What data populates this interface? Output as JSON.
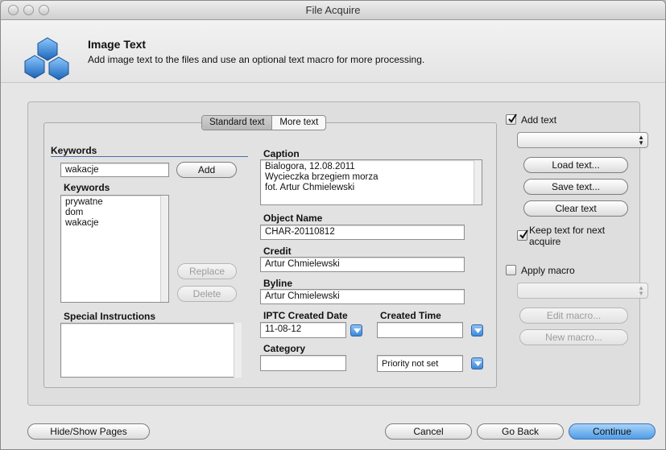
{
  "window": {
    "title": "File Acquire"
  },
  "header": {
    "title": "Image Text",
    "subtitle": "Add image text to the files and use an optional text macro for more processing."
  },
  "tabs": [
    {
      "label": "Standard text",
      "active": true
    },
    {
      "label": "More text",
      "active": false
    }
  ],
  "keywords": {
    "section_label": "Keywords",
    "input_value": "wakacje",
    "add_label": "Add",
    "list_label": "Keywords",
    "items": [
      "prywatne",
      "dom",
      "wakacje"
    ],
    "replace_label": "Replace",
    "delete_label": "Delete"
  },
  "special_instructions": {
    "label": "Special Instructions",
    "value": ""
  },
  "caption": {
    "label": "Caption",
    "lines": [
      "Bialogora, 12.08.2011",
      "Wycieczka brzegiem morza",
      "fot. Artur Chmielewski"
    ]
  },
  "object_name": {
    "label": "Object Name",
    "value": "CHAR-20110812"
  },
  "credit": {
    "label": "Credit",
    "value": "Artur Chmielewski"
  },
  "byline": {
    "label": "Byline",
    "value": "Artur Chmielewski"
  },
  "iptc_created_date": {
    "label": "IPTC Created Date",
    "value": "11-08-12"
  },
  "created_time": {
    "label": "Created Time",
    "value": ""
  },
  "category": {
    "label": "Category",
    "value": ""
  },
  "priority": {
    "value": "Priority not set"
  },
  "sidebar": {
    "add_text_label": "Add text",
    "add_text_checked": true,
    "text_select_value": "",
    "load_text_label": "Load text...",
    "save_text_label": "Save text...",
    "clear_text_label": "Clear text",
    "keep_text_label_1": "Keep text for next",
    "keep_text_label_2": "acquire",
    "keep_text_checked": true,
    "apply_macro_label": "Apply macro",
    "apply_macro_checked": false,
    "macro_select_value": "",
    "edit_macro_label": "Edit macro...",
    "new_macro_label": "New macro..."
  },
  "footer": {
    "hide_show_label": "Hide/Show Pages",
    "cancel_label": "Cancel",
    "go_back_label": "Go Back",
    "continue_label": "Continue"
  },
  "colors": {
    "accent": "#4f9ce6",
    "window_bg": "#e6e6e6",
    "icon_blue": "#2b7fcf"
  }
}
